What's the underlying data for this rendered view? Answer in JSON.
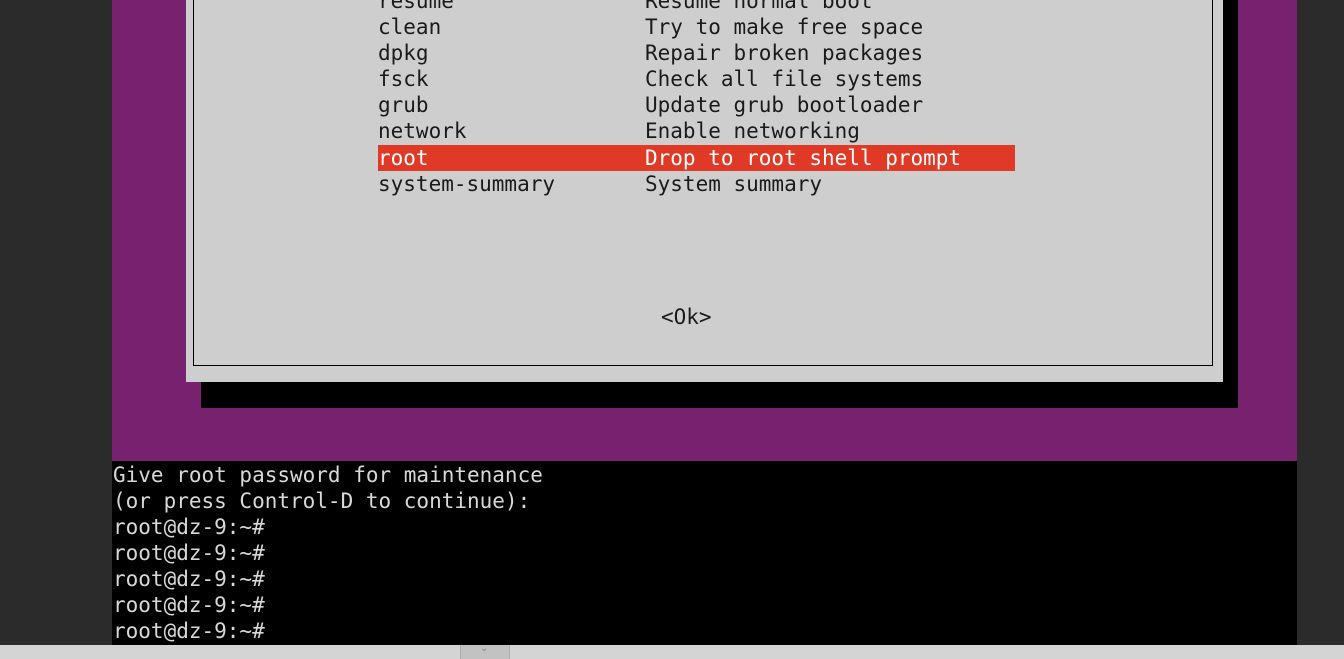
{
  "colors": {
    "outer_background": "#2b2b2b",
    "purple_background": "#77216f",
    "dialog_background": "#cecece",
    "selection_background": "#e03a26",
    "console_background": "#000000"
  },
  "recovery_menu": {
    "items": [
      {
        "tag": "resume",
        "desc": "Resume normal boot",
        "selected": false
      },
      {
        "tag": "clean",
        "desc": "Try to make free space",
        "selected": false
      },
      {
        "tag": "dpkg",
        "desc": "Repair broken packages",
        "selected": false
      },
      {
        "tag": "fsck",
        "desc": "Check all file systems",
        "selected": false
      },
      {
        "tag": "grub",
        "desc": "Update grub bootloader",
        "selected": false
      },
      {
        "tag": "network",
        "desc": "Enable networking",
        "selected": false
      },
      {
        "tag": "root",
        "desc": "Drop to root shell prompt",
        "selected": true
      },
      {
        "tag": "system-summary",
        "desc": "System summary",
        "selected": false
      }
    ],
    "ok_button": "<Ok>"
  },
  "console": {
    "lines": [
      "Give root password for maintenance",
      "(or press Control-D to continue):",
      "root@dz-9:~#",
      "root@dz-9:~#",
      "root@dz-9:~#",
      "root@dz-9:~#",
      "root@dz-9:~#"
    ]
  },
  "bottom_bar": {
    "handle_icon": "chevron-down-icon"
  }
}
